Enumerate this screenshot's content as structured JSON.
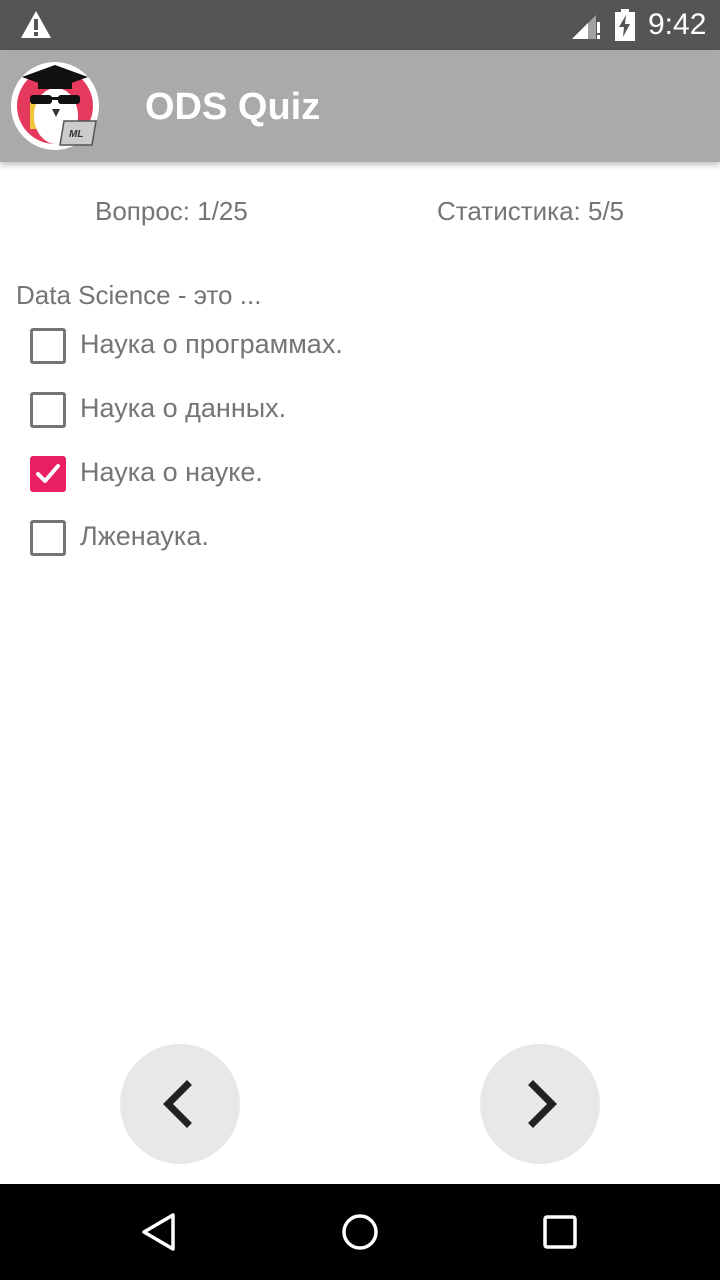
{
  "status_bar": {
    "time": "9:42",
    "icons": [
      "warning-icon",
      "signal-icon",
      "battery-charging-icon"
    ]
  },
  "app_bar": {
    "title": "ODS Quiz",
    "logo_icon": "ods-owl-logo",
    "logo_text": "ML"
  },
  "counters": {
    "question": "Вопрос: 1/25",
    "statistics": "Статистика: 5/5"
  },
  "quiz": {
    "question": "Data Science - это ...",
    "options": [
      {
        "label": "Наука о программах.",
        "checked": false
      },
      {
        "label": "Наука о данных.",
        "checked": false
      },
      {
        "label": "Наука о науке.",
        "checked": true
      },
      {
        "label": "Лженаука.",
        "checked": false
      }
    ]
  },
  "navigation": {
    "prev_icon": "chevron-left-icon",
    "next_icon": "chevron-right-icon"
  },
  "system_nav": {
    "icons": [
      "back-icon",
      "home-icon",
      "recents-icon"
    ]
  },
  "colors": {
    "status_bar": "#555555",
    "app_bar": "#aaaaaa",
    "accent": "#e91e63",
    "text": "#757575",
    "nav_button_bg": "#e8e8e8"
  }
}
